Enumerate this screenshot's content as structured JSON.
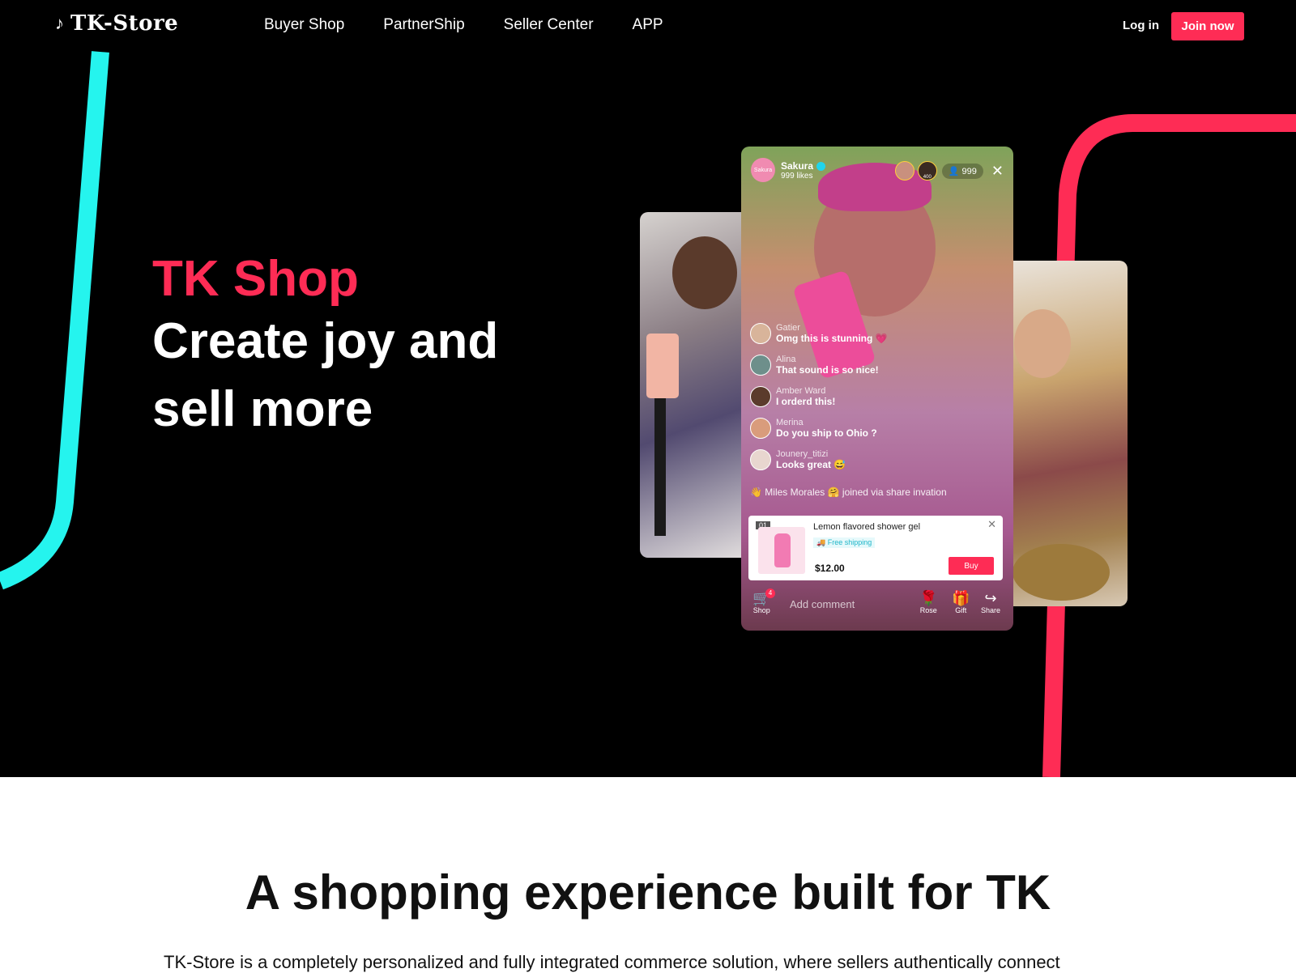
{
  "nav": {
    "logo_text": "TK-Store",
    "links": [
      "Buyer Shop",
      "PartnerShip",
      "Seller Center",
      "APP"
    ],
    "login": "Log in",
    "join": "Join now"
  },
  "hero": {
    "brand": "TK Shop",
    "line1": "Create joy and",
    "line2": "sell more"
  },
  "live": {
    "host_name": "Sakura",
    "host_badge": "Sakura",
    "likes": "999 likes",
    "viewer_badge_1": "400",
    "viewer_count": "999",
    "comments": [
      {
        "user": "Gatier",
        "text": "Omg this is stunning 💗"
      },
      {
        "user": "Alina",
        "text": "That sound is so nice!"
      },
      {
        "user": "Amber Ward",
        "text": "I orderd this!"
      },
      {
        "user": "Merina",
        "text": "Do you ship to Ohio ?"
      },
      {
        "user": "Jounery_titizi",
        "text": "Looks great 😅"
      }
    ],
    "joined": "Miles Morales 🤗 joined via share invation",
    "product": {
      "index": "01",
      "name": "Lemon flavored shower gel",
      "shipping": "Free shipping",
      "price": "$12.00",
      "buy": "Buy"
    },
    "bottom": {
      "shop": "Shop",
      "shop_count": "4",
      "comment_placeholder": "Add comment",
      "rose": "Rose",
      "gift": "Gift",
      "share": "Share"
    }
  },
  "section": {
    "title": "A shopping experience built for TK",
    "text": "TK-Store is a completely personalized and fully integrated commerce solution, where sellers authentically connect"
  },
  "colors": {
    "accent": "#fe2c55",
    "cyan": "#25f4ee",
    "background": "#000000"
  }
}
